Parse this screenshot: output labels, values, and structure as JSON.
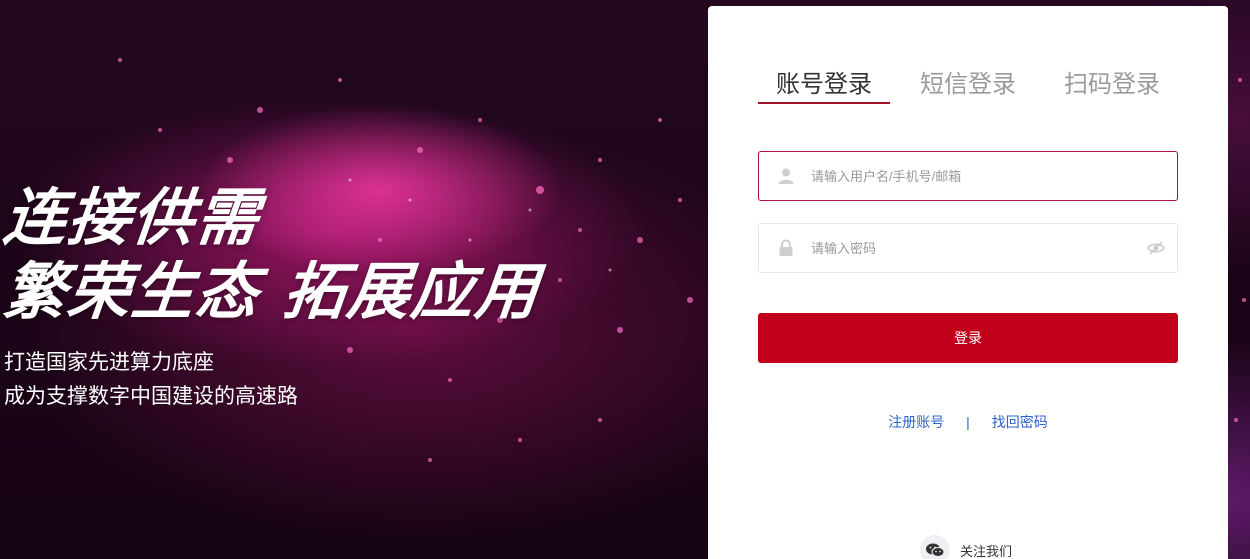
{
  "hero": {
    "line1": "连接供需",
    "line2": "繁荣生态 拓展应用",
    "sub1": "打造国家先进算力底座",
    "sub2": "成为支撑数字中国建设的高速路"
  },
  "login": {
    "tabs": [
      {
        "label": "账号登录",
        "active": true
      },
      {
        "label": "短信登录",
        "active": false
      },
      {
        "label": "扫码登录",
        "active": false
      }
    ],
    "username": {
      "placeholder": "请输入用户名/手机号/邮箱",
      "value": "",
      "icon": "user-icon"
    },
    "password": {
      "placeholder": "请输入密码",
      "value": "",
      "icon": "lock-icon",
      "toggle_icon": "eye-hidden-icon"
    },
    "submit_label": "登录",
    "links": {
      "register": "注册账号",
      "separator": "|",
      "forgot": "找回密码"
    },
    "follow": {
      "icon": "wechat-icon",
      "label": "关注我们"
    }
  },
  "colors": {
    "accent": "#c2001b",
    "link": "#2c63c9",
    "focus_border": "#b3123a"
  }
}
